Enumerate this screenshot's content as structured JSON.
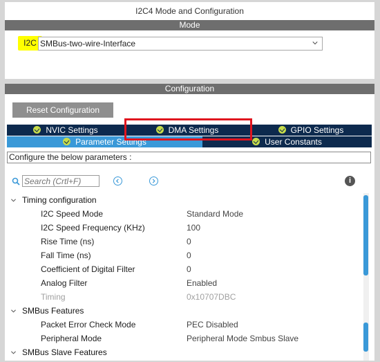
{
  "window_title": "I2C4 Mode and Configuration",
  "mode": {
    "band_label": "Mode",
    "field_label": "I2C",
    "selected_value": "SMBus-two-wire-Interface"
  },
  "configuration": {
    "band_label": "Configuration",
    "reset_button_label": "Reset Configuration",
    "tabs_row1": [
      {
        "label": "NVIC Settings"
      },
      {
        "label": "DMA Settings"
      },
      {
        "label": "GPIO Settings"
      }
    ],
    "tabs_row2": [
      {
        "label": "Parameter Settings",
        "active": true
      },
      {
        "label": "User Constants"
      }
    ],
    "hint": "Configure the below parameters :",
    "search_placeholder": "Search (Crtl+F)",
    "info_icon": "i"
  },
  "tree": {
    "timing_group": {
      "label": "Timing configuration",
      "items": [
        {
          "name": "I2C Speed Mode",
          "value": "Standard Mode"
        },
        {
          "name": "I2C Speed Frequency (KHz)",
          "value": "100"
        },
        {
          "name": "Rise Time (ns)",
          "value": "0"
        },
        {
          "name": "Fall Time (ns)",
          "value": "0"
        },
        {
          "name": "Coefficient of Digital Filter",
          "value": "0"
        },
        {
          "name": "Analog Filter",
          "value": "Enabled"
        },
        {
          "name": "Timing",
          "value": "0x10707DBC"
        }
      ]
    },
    "smbus_group": {
      "label": "SMBus Features",
      "items": [
        {
          "name": "Packet Error Check Mode",
          "value": "PEC Disabled"
        },
        {
          "name": "Peripheral Mode",
          "value": "Peripheral Mode Smbus Slave"
        }
      ]
    },
    "next_group_label": "SMBus Slave Features"
  },
  "colors": {
    "tab_dark": "#0d2a4e",
    "tab_active": "#3a99d8",
    "highlight_box": "#e0141e",
    "label_highlight": "#ffff00"
  }
}
